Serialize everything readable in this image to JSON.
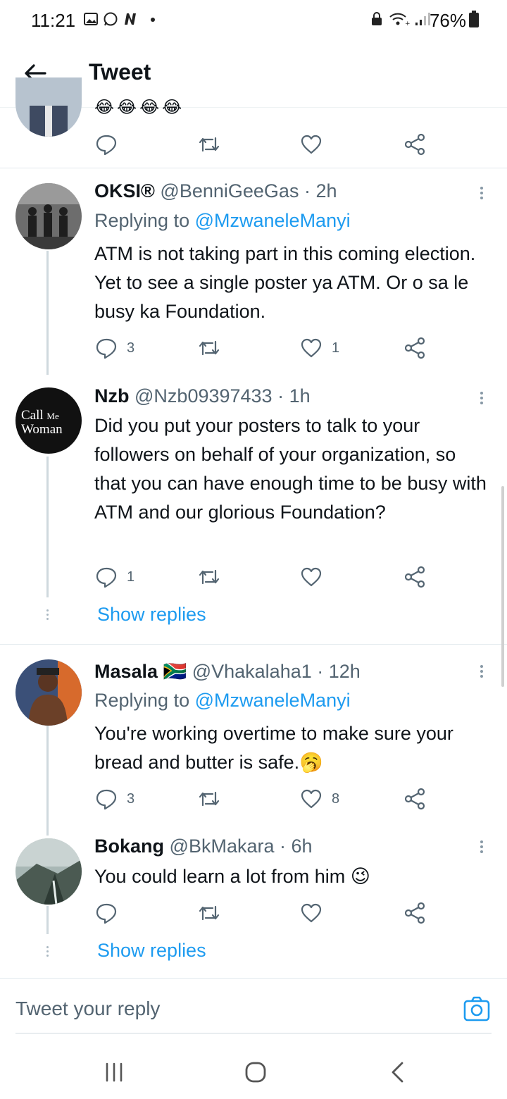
{
  "status_bar": {
    "time": "11:21",
    "battery": "76%"
  },
  "header": {
    "title": "Tweet"
  },
  "top_partial": {
    "emoji": "😂😂😂😂"
  },
  "tweets": [
    {
      "name": "OKSI®",
      "handle": "@BenniGeeGas",
      "time": "· 2h",
      "replying_label": "Replying to",
      "replying_to": "@MzwaneleManyi",
      "text": "ATM is not taking part in this coming election. Yet to see a single poster ya ATM. Or o sa le busy ka Foundation.",
      "replies": "3",
      "retweets": "",
      "likes": "1"
    },
    {
      "name": "Nzb",
      "handle": "@Nzb09397433",
      "time": "· 1h",
      "text": "Did you put your posters to talk to your followers on behalf of your organization, so that you can have enough time to be busy with ATM and our glorious Foundation?",
      "replies": "1",
      "retweets": "",
      "likes": "",
      "avatar_text": {
        "line1": "Call",
        "line1b": "Me",
        "line2": "Woman"
      },
      "show_replies": "Show replies"
    },
    {
      "name": "Masala",
      "flag": "🇿🇦",
      "handle": "@Vhakalaha1",
      "time": "· 12h",
      "replying_label": "Replying to",
      "replying_to": "@MzwaneleManyi",
      "text": "You're working overtime to make sure your bread and butter is safe.🥱",
      "replies": "3",
      "retweets": "",
      "likes": "8"
    },
    {
      "name": "Bokang",
      "handle": "@BkMakara",
      "time": "· 6h",
      "text": "You could learn a lot from him 😉",
      "replies": "",
      "retweets": "",
      "likes": "",
      "show_replies": "Show replies"
    }
  ],
  "reply_box": {
    "placeholder": "Tweet your reply"
  },
  "colors": {
    "accent": "#1d9bf0",
    "text": "#0f1419",
    "secondary": "#536471"
  },
  "icons": [
    "arrow-left-icon",
    "reply-icon",
    "retweet-icon",
    "like-icon",
    "share-icon",
    "camera-icon",
    "more-icon"
  ]
}
